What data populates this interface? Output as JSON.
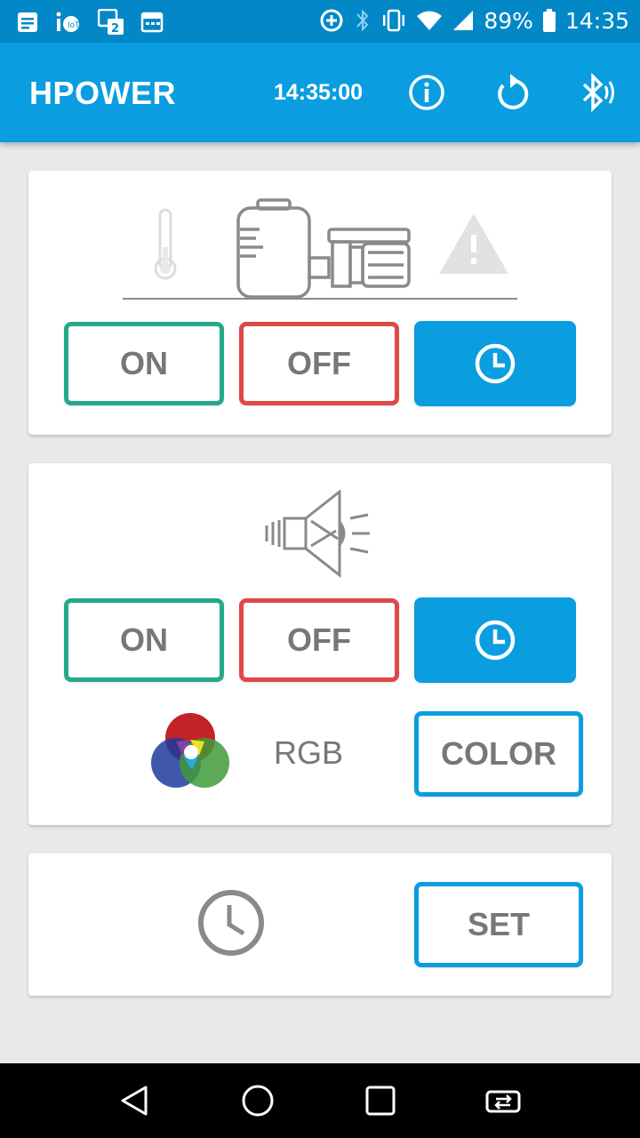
{
  "status_bar": {
    "battery": "89%",
    "time": "14:35",
    "left_icons": [
      "notes-icon",
      "iot-icon",
      "dual-sim-icon",
      "calendar-icon"
    ],
    "right_icons": [
      "data-saver-icon",
      "bluetooth-icon",
      "vibrate-icon",
      "wifi-icon",
      "signal-icon",
      "battery-icon"
    ]
  },
  "app_bar": {
    "title": "HPOWER",
    "clock": "14:35:00",
    "actions": [
      "info-icon",
      "refresh-icon",
      "bluetooth-connected-icon"
    ]
  },
  "pump_card": {
    "icons": [
      "thermometer-icon",
      "pump-icon",
      "warning-icon"
    ],
    "on_label": "ON",
    "off_label": "OFF",
    "timer_icon": "clock-icon"
  },
  "light_card": {
    "icon": "speaker-icon",
    "on_label": "ON",
    "off_label": "OFF",
    "timer_icon": "clock-icon",
    "rgb_label": "RGB",
    "color_label": "COLOR"
  },
  "clock_card": {
    "icon": "clock-icon",
    "set_label": "SET"
  },
  "colors": {
    "primary": "#0a9ee0",
    "status_bar": "#0288c7",
    "on": "#24a98a",
    "off": "#e04848",
    "text_gray": "#777777"
  },
  "nav_bar": [
    "back-icon",
    "home-icon",
    "recents-icon",
    "screen-switch-icon"
  ]
}
